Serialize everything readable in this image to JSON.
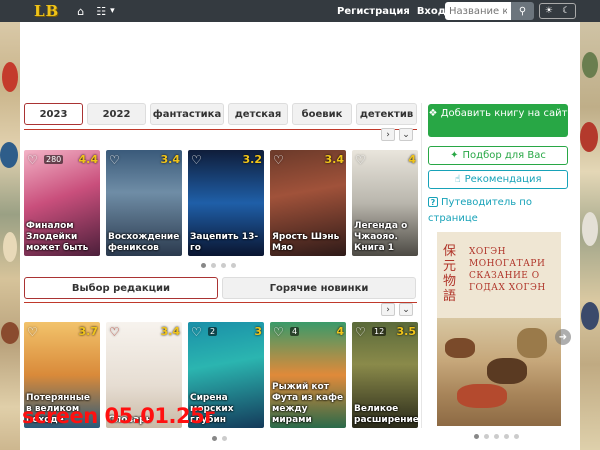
{
  "nav": {
    "logo": "LB",
    "home_icon": "home-icon",
    "library_icon": "books-icon",
    "register": "Регистрация",
    "login": "Вход",
    "search_placeholder": "Название книги",
    "search_icon": "search-icon",
    "theme_icons": [
      "sun-icon",
      "moon-icon"
    ]
  },
  "filter_tabs": [
    "2023",
    "2022",
    "фантастика",
    "детская",
    "боевик",
    "детектив"
  ],
  "active_filter": "2023",
  "row1": [
    {
      "title": "Финалом Злодейки может быть",
      "count": "280",
      "rating": "4.4"
    },
    {
      "title": "Восхождение фениксов",
      "count": "",
      "rating": "3.4"
    },
    {
      "title": "Зацепить 13-го",
      "count": "",
      "rating": "3.2"
    },
    {
      "title": "Ярость Шэнь Мяо",
      "count": "",
      "rating": "3.4"
    },
    {
      "title": "Легенда о Чжаояо. Книга 1",
      "count": "",
      "rating": "4"
    }
  ],
  "row2_tabs": [
    "Выбор редакции",
    "Горячие новинки"
  ],
  "row2": [
    {
      "title": "Потерянные в великом походе",
      "count": "",
      "rating": "3.7"
    },
    {
      "title": "Словарь",
      "count": "",
      "rating": "3.4"
    },
    {
      "title": "Сирена морских глубин",
      "count": "2",
      "rating": "3"
    },
    {
      "title": "Рыжий кот Фута из кафе между мирами",
      "count": "4",
      "rating": "4"
    },
    {
      "title": "Великое расширение",
      "count": "12",
      "rating": "3.5"
    }
  ],
  "sidebar": {
    "add_book": "Добавить книгу на сайт",
    "for_you": "Подбор для Вас",
    "recommend": "Рекомендация",
    "guide": "Путеводитель по странице",
    "promo_title": "ХОГЭН МОНОГАТАРИ СКАЗАНИЕ О ГОДАХ ХОГЭН",
    "promo_cjk": "保元物語"
  },
  "watermark": "screen 05.01.25г",
  "colors": {
    "accent_green": "#28a745",
    "accent_blue": "#17a2b8",
    "tab_red": "#c0392b",
    "navbar": "#343a40"
  }
}
